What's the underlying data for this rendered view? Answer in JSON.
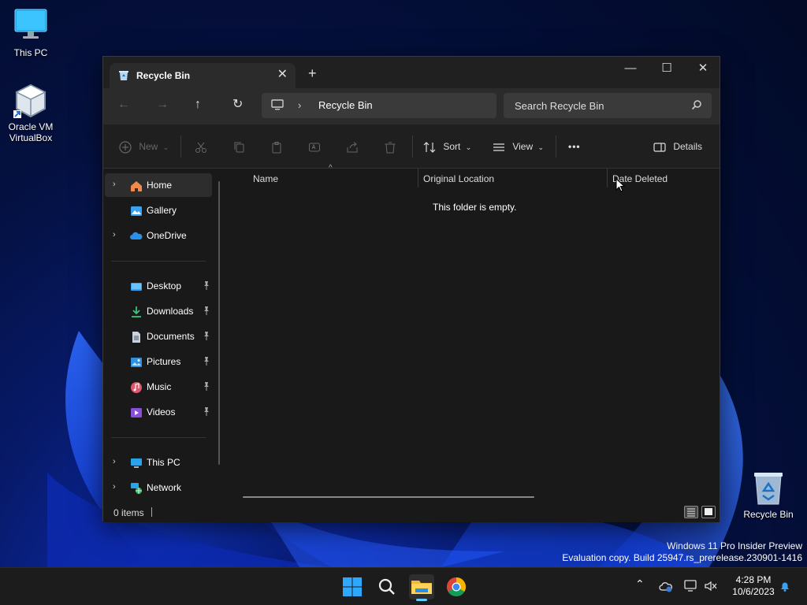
{
  "desktop": {
    "icons": [
      {
        "label": "This PC"
      },
      {
        "label": "Oracle VM VirtualBox"
      },
      {
        "label": "Recycle Bin"
      }
    ],
    "watermark_line1": "Windows 11 Pro Insider Preview",
    "watermark_line2": "Evaluation copy. Build 25947.rs_prerelease.230901-1416"
  },
  "window": {
    "tab_title": "Recycle Bin",
    "tab_close": "✕",
    "new_tab": "+",
    "controls": {
      "minimize": "—",
      "maximize": "☐",
      "close": "✕"
    },
    "nav": {
      "back": "←",
      "forward": "→",
      "up": "↑",
      "refresh": "↻"
    },
    "address": {
      "chevron": "›",
      "crumb": "Recycle Bin"
    },
    "search_placeholder": "Search Recycle Bin",
    "toolbar": {
      "new_label": "New",
      "sort_label": "Sort",
      "view_label": "View",
      "more_label": "•••",
      "details_label": "Details"
    },
    "sidebar": {
      "items": [
        {
          "label": "Home"
        },
        {
          "label": "Gallery"
        },
        {
          "label": "OneDrive"
        },
        {
          "label": "Desktop"
        },
        {
          "label": "Downloads"
        },
        {
          "label": "Documents"
        },
        {
          "label": "Pictures"
        },
        {
          "label": "Music"
        },
        {
          "label": "Videos"
        },
        {
          "label": "This PC"
        },
        {
          "label": "Network"
        }
      ]
    },
    "columns": [
      "Name",
      "Original Location",
      "Date Deleted"
    ],
    "empty_message": "This folder is empty.",
    "status": {
      "count": "0 items"
    }
  },
  "taskbar": {
    "time": "4:28 PM",
    "date": "10/6/2023"
  },
  "colors": {
    "accent": "#0078d4",
    "window_bg": "#191919",
    "toolbar_bg": "#2b2b2b"
  }
}
